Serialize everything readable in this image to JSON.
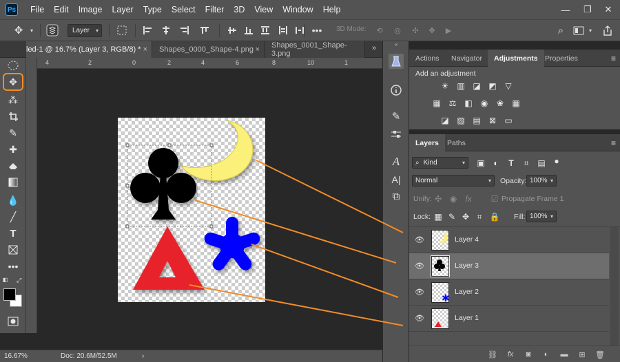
{
  "app": {
    "logo": "Ps"
  },
  "menu": [
    "File",
    "Edit",
    "Image",
    "Layer",
    "Type",
    "Select",
    "Filter",
    "3D",
    "View",
    "Window",
    "Help"
  ],
  "options_bar": {
    "auto_select_target": "Layer",
    "mode_3d_label": "3D Mode:"
  },
  "tabs": [
    {
      "label": "led-1 @ 16.7% (Layer 3, RGB/8) *",
      "close": "×",
      "active": true
    },
    {
      "label": "Shapes_0000_Shape-4.png",
      "close": "×",
      "active": false
    },
    {
      "label": "Shapes_0001_Shape-3.png",
      "close": "×",
      "active": false
    }
  ],
  "tabs_overflow": "»",
  "rulers": {
    "h_ticks": [
      "4",
      "2",
      "0",
      "2",
      "4",
      "6",
      "8",
      "10",
      "1"
    ]
  },
  "status": {
    "zoom": "16.67%",
    "doc": "Doc: 20.6M/52.5M",
    "arrow": "›"
  },
  "colors": {
    "highlight": "#f28c28",
    "moon": "#faf07a",
    "club": "#000000",
    "star": "#0000ff",
    "triangle": "#e8202a",
    "arrow": "#f28c28"
  },
  "top_panel": {
    "tabs": [
      "Actions",
      "Navigator",
      "Adjustments",
      "Properties"
    ],
    "active_tab": "Adjustments",
    "heading": "Add an adjustment"
  },
  "layers_panel": {
    "tabs": [
      "Layers",
      "Paths"
    ],
    "active_tab": "Layers",
    "filter_kind": "Kind",
    "blend_mode": "Normal",
    "opacity_label": "Opacity:",
    "opacity_value": "100%",
    "unify_label": "Unify:",
    "propagate_label": "Propagate Frame 1",
    "lock_label": "Lock:",
    "fill_label": "Fill:",
    "fill_value": "100%",
    "layers": [
      {
        "name": "Layer 4",
        "selected": false,
        "thumb": "moon"
      },
      {
        "name": "Layer 3",
        "selected": true,
        "thumb": "club"
      },
      {
        "name": "Layer 2",
        "selected": false,
        "thumb": "star"
      },
      {
        "name": "Layer 1",
        "selected": false,
        "thumb": "triangle"
      }
    ]
  }
}
